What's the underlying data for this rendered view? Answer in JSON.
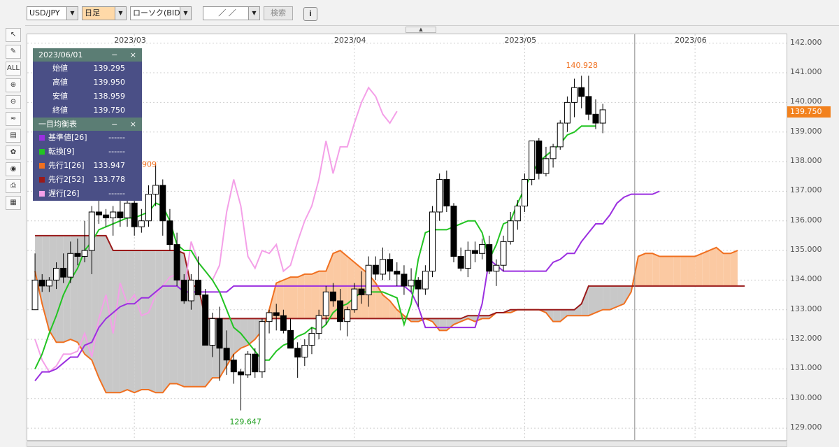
{
  "toolbar": {
    "symbol": "USD/JPY",
    "timeframe": "日足",
    "chart_type": "ローソク(BID)",
    "date_input": "／ ／",
    "search_label": "検索",
    "info_icon": "i"
  },
  "tools": [
    {
      "name": "pointer-tool",
      "glyph": "↖"
    },
    {
      "name": "pencil-tool",
      "glyph": "✎"
    },
    {
      "name": "erase-all-tool",
      "glyph": "ALL"
    },
    {
      "name": "zoom-in-tool",
      "glyph": "⊕"
    },
    {
      "name": "zoom-out-tool",
      "glyph": "⊖"
    },
    {
      "name": "indicator-tool",
      "glyph": "≈"
    },
    {
      "name": "price-table-tool",
      "glyph": "▤"
    },
    {
      "name": "palette-tool",
      "glyph": "✿"
    },
    {
      "name": "eye-tool",
      "glyph": "◉"
    },
    {
      "name": "print-tool",
      "glyph": "⎙"
    },
    {
      "name": "grid-tool",
      "glyph": "▦"
    }
  ],
  "info_panel": {
    "date": "2023/06/01",
    "ohlc": [
      {
        "label": "始値",
        "value": "139.295"
      },
      {
        "label": "高値",
        "value": "139.950"
      },
      {
        "label": "安値",
        "value": "138.959"
      },
      {
        "label": "終値",
        "value": "139.750"
      }
    ],
    "ichimoku_title": "一目均衡表",
    "ichimoku": [
      {
        "label": "基準値[26]",
        "value": "------",
        "color": "#9b2fe0"
      },
      {
        "label": "転換[9]",
        "value": "------",
        "color": "#22c422"
      },
      {
        "label": "先行1[26]",
        "value": "133.947",
        "color": "#f07020"
      },
      {
        "label": "先行2[52]",
        "value": "133.778",
        "color": "#9a1a1a"
      },
      {
        "label": "遅行[26]",
        "value": "------",
        "color": "#f4a0e8"
      }
    ],
    "minimize": "−",
    "close": "×"
  },
  "current_price": "139.750",
  "annotations": {
    "high": "140.928",
    "low": "129.647",
    "partial": "909"
  },
  "chart_data": {
    "type": "candlestick",
    "x_ticks": [
      "2023/03",
      "2023/04",
      "2023/05",
      "2023/06"
    ],
    "y_ticks": [
      "142.000",
      "141.000",
      "140.000",
      "139.000",
      "138.000",
      "137.000",
      "136.000",
      "135.000",
      "134.000",
      "133.000",
      "132.000",
      "131.000",
      "130.000",
      "129.000"
    ],
    "ylim": [
      128.6,
      142.3
    ],
    "candles": [
      [
        133.0,
        134.9,
        133.0,
        134.0
      ],
      [
        134.0,
        134.2,
        133.6,
        133.8
      ],
      [
        133.8,
        134.1,
        133.6,
        134.0
      ],
      [
        134.0,
        134.6,
        133.7,
        134.4
      ],
      [
        134.4,
        134.9,
        133.9,
        134.1
      ],
      [
        134.1,
        135.3,
        133.9,
        134.9
      ],
      [
        134.9,
        135.4,
        134.5,
        134.8
      ],
      [
        134.8,
        136.0,
        134.6,
        135.0
      ],
      [
        135.0,
        136.5,
        134.2,
        136.3
      ],
      [
        136.3,
        137.5,
        135.9,
        136.2
      ],
      [
        136.2,
        136.4,
        135.8,
        136.1
      ],
      [
        136.1,
        136.5,
        135.5,
        136.3
      ],
      [
        136.3,
        136.7,
        135.8,
        136.1
      ],
      [
        136.1,
        136.8,
        135.8,
        136.6
      ],
      [
        136.6,
        137.1,
        135.5,
        135.8
      ],
      [
        135.8,
        136.4,
        135.6,
        136.0
      ],
      [
        136.0,
        137.2,
        135.8,
        136.9
      ],
      [
        136.9,
        137.9,
        136.5,
        137.2
      ],
      [
        137.2,
        137.4,
        135.5,
        136.0
      ],
      [
        136.0,
        136.4,
        135.0,
        135.2
      ],
      [
        135.2,
        135.6,
        133.8,
        134.0
      ],
      [
        134.0,
        134.2,
        133.2,
        133.3
      ],
      [
        133.3,
        134.2,
        133.0,
        134.0
      ],
      [
        134.0,
        134.8,
        133.5,
        133.5
      ],
      [
        133.5,
        133.7,
        131.8,
        131.8
      ],
      [
        131.8,
        132.9,
        131.4,
        132.7
      ],
      [
        132.7,
        133.1,
        130.6,
        131.7
      ],
      [
        131.7,
        132.3,
        130.8,
        131.3
      ],
      [
        131.3,
        131.5,
        130.5,
        130.9
      ],
      [
        130.9,
        131.0,
        129.6,
        130.8
      ],
      [
        130.8,
        131.6,
        130.7,
        131.5
      ],
      [
        131.5,
        131.7,
        130.7,
        130.9
      ],
      [
        130.9,
        132.7,
        130.7,
        132.6
      ],
      [
        132.6,
        133.0,
        132.2,
        132.9
      ],
      [
        132.9,
        133.2,
        132.3,
        132.8
      ],
      [
        132.8,
        133.0,
        132.2,
        132.3
      ],
      [
        132.3,
        132.7,
        131.8,
        131.7
      ],
      [
        131.7,
        131.9,
        130.7,
        131.4
      ],
      [
        131.4,
        132.0,
        131.1,
        131.8
      ],
      [
        131.8,
        132.4,
        131.5,
        132.2
      ],
      [
        132.2,
        133.0,
        132.0,
        132.8
      ],
      [
        132.8,
        133.8,
        132.5,
        133.6
      ],
      [
        133.6,
        133.9,
        133.1,
        133.3
      ],
      [
        133.3,
        133.7,
        132.3,
        132.6
      ],
      [
        132.6,
        133.1,
        132.1,
        133.0
      ],
      [
        133.0,
        133.9,
        132.9,
        133.7
      ],
      [
        133.7,
        134.3,
        133.2,
        133.5
      ],
      [
        133.5,
        134.8,
        133.1,
        134.5
      ],
      [
        134.5,
        134.8,
        134.0,
        134.2
      ],
      [
        134.2,
        135.1,
        134.0,
        134.7
      ],
      [
        134.7,
        134.9,
        134.0,
        134.3
      ],
      [
        134.3,
        134.6,
        133.8,
        134.2
      ],
      [
        134.2,
        134.5,
        133.5,
        133.8
      ],
      [
        133.8,
        134.4,
        133.6,
        134.0
      ],
      [
        134.0,
        134.1,
        133.1,
        133.7
      ],
      [
        133.7,
        134.5,
        133.5,
        134.3
      ],
      [
        134.3,
        136.5,
        134.1,
        136.3
      ],
      [
        136.3,
        137.6,
        136.0,
        137.4
      ],
      [
        137.4,
        137.7,
        136.3,
        136.5
      ],
      [
        136.5,
        136.6,
        134.6,
        134.8
      ],
      [
        134.8,
        135.1,
        134.3,
        134.4
      ],
      [
        134.4,
        135.3,
        134.1,
        135.0
      ],
      [
        135.0,
        135.3,
        134.6,
        134.9
      ],
      [
        134.9,
        135.4,
        134.7,
        135.2
      ],
      [
        135.2,
        135.5,
        134.2,
        134.3
      ],
      [
        134.3,
        134.7,
        133.8,
        134.5
      ],
      [
        134.5,
        135.5,
        134.3,
        135.3
      ],
      [
        135.3,
        136.3,
        135.2,
        136.0
      ],
      [
        136.0,
        136.7,
        135.7,
        136.5
      ],
      [
        136.5,
        137.6,
        136.3,
        137.4
      ],
      [
        137.4,
        138.7,
        137.2,
        138.7
      ],
      [
        138.7,
        138.8,
        137.4,
        137.6
      ],
      [
        137.6,
        138.5,
        137.5,
        138.1
      ],
      [
        138.1,
        138.6,
        137.8,
        138.5
      ],
      [
        138.5,
        139.4,
        138.4,
        139.3
      ],
      [
        139.3,
        140.2,
        139.0,
        140.0
      ],
      [
        140.0,
        140.8,
        139.5,
        140.5
      ],
      [
        140.5,
        140.9,
        139.8,
        140.2
      ],
      [
        140.2,
        140.9,
        139.4,
        139.6
      ],
      [
        139.6,
        140.1,
        139.1,
        139.3
      ],
      [
        139.3,
        139.95,
        138.96,
        139.75
      ]
    ],
    "kumo_span_a_x": [
      0,
      1,
      2,
      3,
      4,
      5,
      6,
      7,
      8,
      9,
      10,
      11,
      12,
      13,
      14,
      15,
      16,
      17,
      18,
      19,
      20,
      21,
      22,
      23,
      24,
      25,
      26,
      27,
      28,
      29,
      30,
      31,
      32,
      33,
      34,
      35,
      36,
      37,
      38,
      39,
      40,
      41,
      42,
      43,
      44,
      45,
      46,
      47,
      48,
      49,
      50,
      51,
      52,
      53,
      54,
      55,
      56,
      57,
      58,
      59,
      60,
      61,
      62,
      63,
      64,
      65,
      66,
      67,
      68,
      69,
      70,
      71,
      72,
      73,
      74,
      75,
      76,
      77,
      78,
      79,
      80,
      81,
      82,
      83,
      84,
      85,
      86,
      87,
      88,
      89,
      90,
      91,
      92,
      93,
      94,
      95,
      96,
      97,
      98,
      99,
      100,
      101,
      102,
      103,
      104,
      105,
      106
    ],
    "kumo_span_a": [
      134.3,
      133.2,
      132.3,
      131.9,
      131.9,
      132.0,
      131.9,
      131.5,
      131.3,
      130.7,
      130.2,
      130.2,
      130.2,
      130.3,
      130.2,
      130.3,
      130.3,
      130.2,
      130.2,
      130.5,
      130.5,
      130.4,
      130.4,
      130.4,
      130.4,
      130.7,
      130.7,
      131.1,
      131.5,
      131.7,
      131.8,
      132.0,
      132.3,
      133.0,
      133.9,
      134.0,
      134.1,
      134.1,
      134.2,
      134.2,
      134.3,
      134.3,
      134.9,
      135.0,
      134.8,
      134.6,
      134.4,
      134.2,
      133.9,
      133.5,
      133.3,
      133.0,
      132.8,
      132.6,
      132.6,
      132.7,
      132.6,
      132.3,
      132.3,
      132.5,
      132.6,
      132.7,
      132.6,
      132.7,
      132.7,
      132.9,
      132.9,
      132.9,
      133.0,
      133.0,
      133.0,
      133.0,
      132.9,
      132.6,
      132.6,
      132.8,
      132.8,
      132.8,
      132.8,
      132.9,
      133.0,
      133.0,
      133.1,
      133.2,
      133.6,
      134.8,
      134.9,
      134.9,
      134.8,
      134.8,
      134.8,
      134.8,
      134.8,
      134.8,
      134.9,
      135.0,
      135.1,
      134.9,
      134.9,
      135.0
    ],
    "kumo_span_b": [
      135.5,
      135.5,
      135.5,
      135.5,
      135.5,
      135.5,
      135.5,
      135.5,
      135.5,
      135.5,
      135.5,
      135.0,
      135.0,
      135.0,
      135.0,
      135.0,
      135.0,
      135.0,
      135.0,
      135.0,
      135.0,
      134.9,
      133.8,
      133.8,
      132.7,
      132.7,
      132.7,
      132.7,
      132.7,
      132.7,
      132.7,
      132.7,
      132.7,
      132.7,
      132.7,
      132.7,
      132.7,
      132.7,
      132.7,
      132.7,
      132.7,
      132.7,
      132.7,
      132.7,
      132.7,
      132.7,
      132.7,
      132.7,
      132.7,
      132.7,
      132.7,
      132.7,
      132.7,
      132.7,
      132.7,
      132.7,
      132.7,
      132.7,
      132.7,
      132.7,
      132.7,
      132.8,
      132.8,
      132.8,
      132.8,
      132.9,
      132.9,
      133.0,
      133.0,
      133.0,
      133.0,
      133.0,
      133.0,
      133.0,
      133.0,
      133.0,
      133.0,
      133.2,
      133.8,
      133.8,
      133.8,
      133.8,
      133.8,
      133.8,
      133.8,
      133.8,
      133.8,
      133.8,
      133.8,
      133.8,
      133.8,
      133.8,
      133.8,
      133.8,
      133.8,
      133.8,
      133.8,
      133.8,
      133.8,
      133.8,
      133.8
    ],
    "kijun": [
      130.6,
      130.9,
      130.9,
      131.0,
      131.2,
      131.4,
      131.4,
      131.8,
      131.9,
      132.4,
      132.7,
      132.9,
      133.1,
      133.2,
      133.2,
      133.4,
      133.4,
      133.6,
      133.8,
      133.8,
      133.8,
      133.6,
      133.6,
      133.6,
      133.6,
      133.6,
      133.6,
      133.6,
      133.8,
      133.8,
      133.8,
      133.8,
      133.8,
      133.8,
      133.8,
      133.8,
      133.8,
      133.8,
      133.8,
      133.8,
      133.8,
      133.8,
      133.8,
      133.8,
      133.8,
      133.8,
      133.8,
      133.8,
      133.8,
      133.8,
      133.8,
      133.8,
      133.8,
      133.6,
      133.1,
      132.4,
      132.4,
      132.4,
      132.4,
      132.4,
      132.4,
      132.4,
      132.4,
      133.2,
      134.7,
      134.5,
      134.3,
      134.3,
      134.3,
      134.3,
      134.3,
      134.3,
      134.3,
      134.6,
      134.7,
      134.9,
      134.9,
      135.3,
      135.6,
      135.9,
      135.9,
      136.2,
      136.6,
      136.8,
      136.9,
      136.9,
      136.9,
      136.9,
      137.0
    ],
    "tenkan": [
      131.0,
      131.5,
      132.2,
      132.8,
      133.5,
      134.0,
      134.4,
      135.0,
      135.3,
      135.7,
      135.8,
      135.9,
      136.0,
      136.1,
      136.1,
      136.2,
      136.3,
      136.6,
      136.5,
      136.0,
      135.2,
      135.0,
      135.0,
      134.6,
      134.3,
      134.0,
      133.6,
      133.0,
      132.4,
      132.2,
      131.9,
      131.6,
      131.3,
      131.3,
      131.6,
      131.8,
      131.9,
      132.1,
      132.2,
      132.4,
      132.3,
      132.5,
      132.9,
      133.1,
      133.2,
      133.4,
      133.6,
      133.6,
      133.6,
      133.6,
      133.5,
      133.4,
      132.5,
      133.2,
      134.7,
      135.6,
      135.7,
      135.7,
      135.7,
      135.8,
      135.9,
      136.0,
      136.0,
      135.6,
      134.7,
      135.2,
      135.9,
      136.0,
      136.6,
      137.1,
      137.6,
      138.0,
      138.2,
      138.4,
      138.6,
      138.9,
      139.0,
      139.2,
      139.2,
      139.2
    ],
    "chikou": [
      132.0,
      131.3,
      130.9,
      131.1,
      131.5,
      131.5,
      131.6,
      132.2,
      131.4,
      132.7,
      133.5,
      132.2,
      133.9,
      133.2,
      133.5,
      132.8,
      132.9,
      133.5,
      133.8,
      134.1,
      134.2,
      133.6,
      135.3,
      134.6,
      134.3,
      134.0,
      134.5,
      136.3,
      137.4,
      136.5,
      134.8,
      134.4,
      135.0,
      134.9,
      135.2,
      134.3,
      134.5,
      135.3,
      136.0,
      136.5,
      137.4,
      138.7,
      137.6,
      138.5,
      138.5,
      139.3,
      140.0,
      140.5,
      140.2,
      139.6,
      139.3,
      139.7
    ]
  }
}
